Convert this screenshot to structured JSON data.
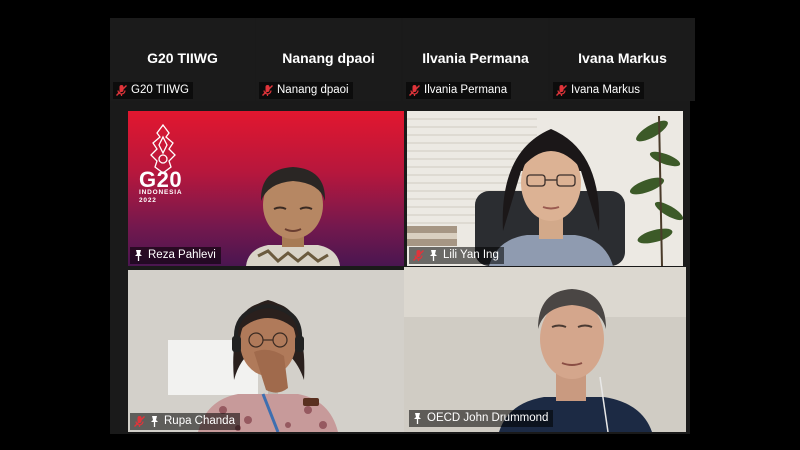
{
  "top_strip": [
    {
      "name": "G20 TIIWG",
      "label": "G20 TIIWG"
    },
    {
      "name": "Nanang dpaoi",
      "label": "Nanang dpaoi"
    },
    {
      "name": "Ilvania Permana",
      "label": "Ilvania Permana"
    },
    {
      "name": "Ivana Markus",
      "label": "Ivana Markus"
    }
  ],
  "tiles": [
    {
      "name": "Reza Pahlevi",
      "background_text": {
        "logo": "G20",
        "line1": "INDONESIA",
        "line2": "2022"
      }
    },
    {
      "name": "Lili Yan Ing"
    },
    {
      "name": "Rupa Chanda"
    },
    {
      "name": "OECD John Drummond"
    }
  ],
  "colors": {
    "active_speaker_border": "#c6e04a",
    "muted_icon": "#e0343a",
    "background": "#000000",
    "strip_background": "#1b1b1b"
  }
}
